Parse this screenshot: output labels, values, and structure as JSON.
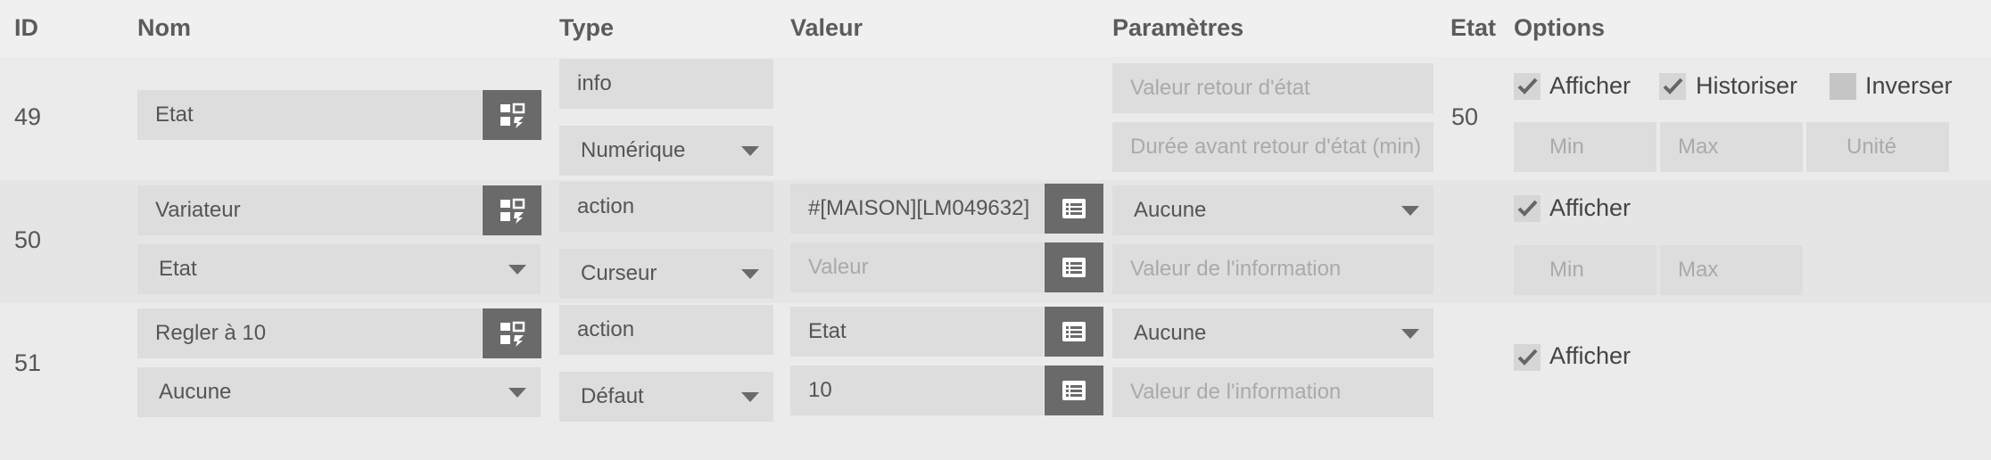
{
  "headers": {
    "id": "ID",
    "nom": "Nom",
    "type": "Type",
    "valeur": "Valeur",
    "parametres": "Paramètres",
    "etat": "Etat",
    "options": "Options"
  },
  "rows": [
    {
      "id": "49",
      "nom": "Etat",
      "type": "info",
      "subtype": "Numérique",
      "param1_placeholder": "Valeur retour d'état",
      "param2_placeholder": "Durée avant retour d'état (min)",
      "etat": "50",
      "options": {
        "afficher": "Afficher",
        "afficher_checked": true,
        "historiser": "Historiser",
        "historiser_checked": true,
        "inverser": "Inverser",
        "inverser_checked": false
      },
      "min_placeholder": "Min",
      "max_placeholder": "Max",
      "unite_placeholder": "Unité"
    },
    {
      "id": "50",
      "nom": "Variateur",
      "nom_select": "Etat",
      "type": "action",
      "subtype": "Curseur",
      "valeur": "#[MAISON][LM049632]",
      "valeur_placeholder": "Valeur",
      "param_select": "Aucune",
      "param2_placeholder": "Valeur de l'information",
      "options": {
        "afficher": "Afficher",
        "afficher_checked": true
      },
      "min_placeholder": "Min",
      "max_placeholder": "Max"
    },
    {
      "id": "51",
      "nom": "Regler à 10",
      "nom_select": "Aucune",
      "type": "action",
      "subtype": "Défaut",
      "valeur": "Etat",
      "valeur2": "10",
      "param_select": "Aucune",
      "param2_placeholder": "Valeur de l'information",
      "options": {
        "afficher": "Afficher",
        "afficher_checked": true
      }
    }
  ],
  "icons": {
    "configure": "configure-icon",
    "list": "list-icon",
    "check": "check-icon",
    "dropdown": "chevron-down-icon"
  },
  "colors": {
    "button_bg": "#6a6a6a",
    "field_bg": "#dcdddc"
  }
}
